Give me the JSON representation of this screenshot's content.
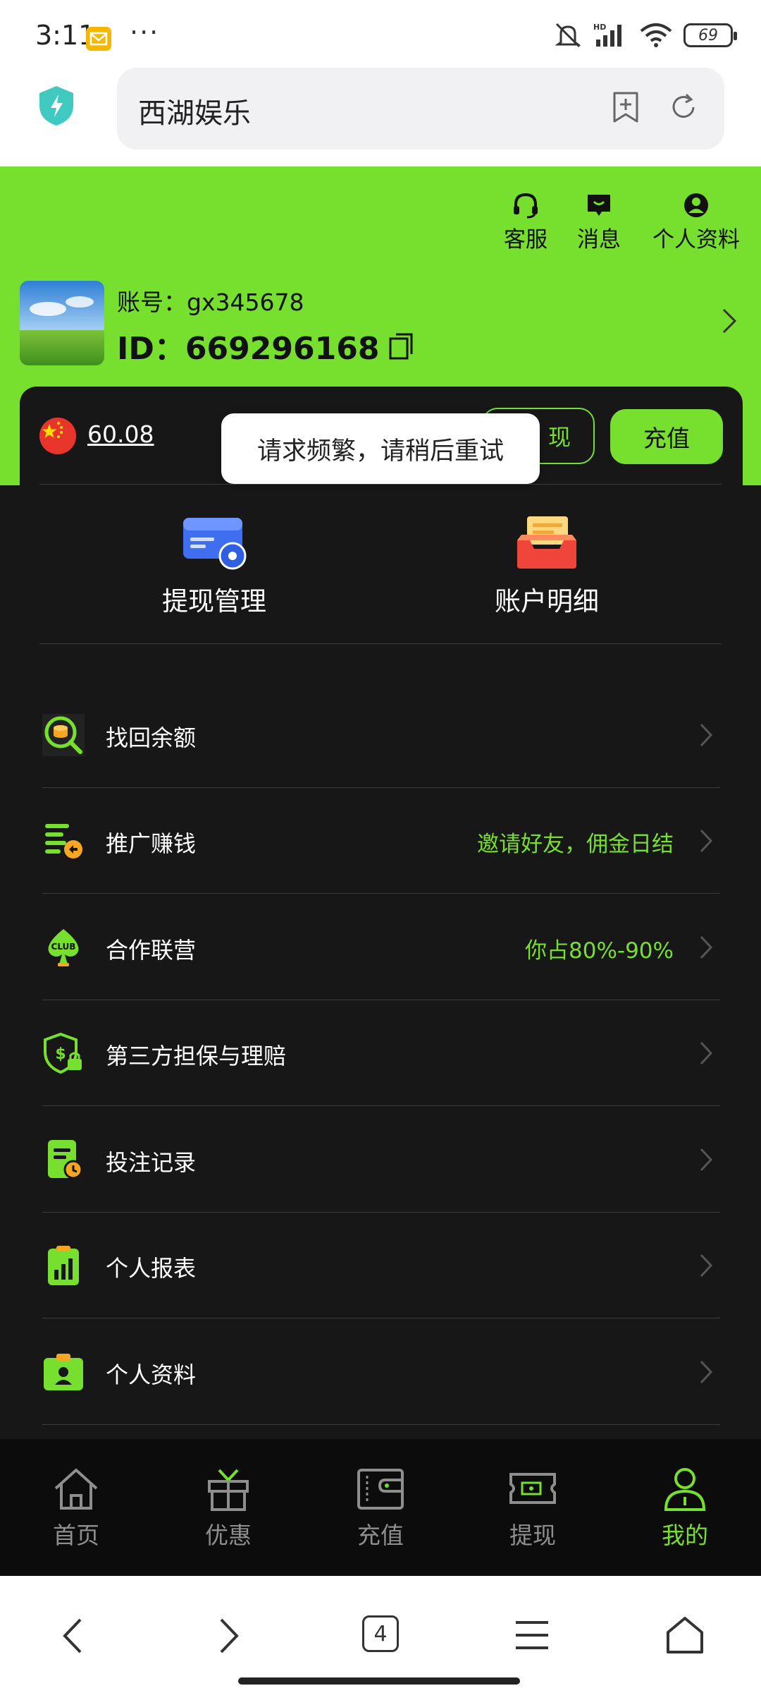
{
  "status_bar": {
    "time": "3:11",
    "dots": "···",
    "battery": "69"
  },
  "browser": {
    "url_title": "西湖娱乐",
    "tab_count": "4"
  },
  "header": {
    "actions": [
      {
        "label": "客服",
        "icon": "headset-icon"
      },
      {
        "label": "消息",
        "icon": "message-icon"
      },
      {
        "label": "个人资料",
        "icon": "profile-icon"
      }
    ],
    "account_label": "账号：gx345678",
    "id_label": "ID：669296168"
  },
  "wallet": {
    "balance": "60.08",
    "withdraw_label": "现",
    "deposit_label": "充值"
  },
  "toast": {
    "message": "请求频繁，请稍后重试"
  },
  "quick_actions": [
    {
      "label": "提现管理",
      "icon": "card-settings-icon"
    },
    {
      "label": "账户明细",
      "icon": "inbox-tray-icon"
    }
  ],
  "menu": [
    {
      "label": "找回余额",
      "sub": "",
      "icon": "search-coins-icon"
    },
    {
      "label": "推广赚钱",
      "sub": "邀请好友，佣金日结",
      "icon": "share-list-icon"
    },
    {
      "label": "合作联营",
      "sub": "你占80%-90%",
      "icon": "club-icon"
    },
    {
      "label": "第三方担保与理赔",
      "sub": "",
      "icon": "shield-lock-icon"
    },
    {
      "label": "投注记录",
      "sub": "",
      "icon": "bet-record-icon"
    },
    {
      "label": "个人报表",
      "sub": "",
      "icon": "report-icon"
    },
    {
      "label": "个人资料",
      "sub": "",
      "icon": "id-card-icon"
    }
  ],
  "tabbar": [
    {
      "label": "首页",
      "icon": "home-icon"
    },
    {
      "label": "优惠",
      "icon": "gift-icon"
    },
    {
      "label": "充值",
      "icon": "wallet-icon"
    },
    {
      "label": "提现",
      "icon": "cash-ticket-icon"
    },
    {
      "label": "我的",
      "icon": "user-icon",
      "active": true
    }
  ],
  "colors": {
    "accent": "#77df2e",
    "panel": "#171717",
    "tabbar": "#0c0c0c"
  }
}
